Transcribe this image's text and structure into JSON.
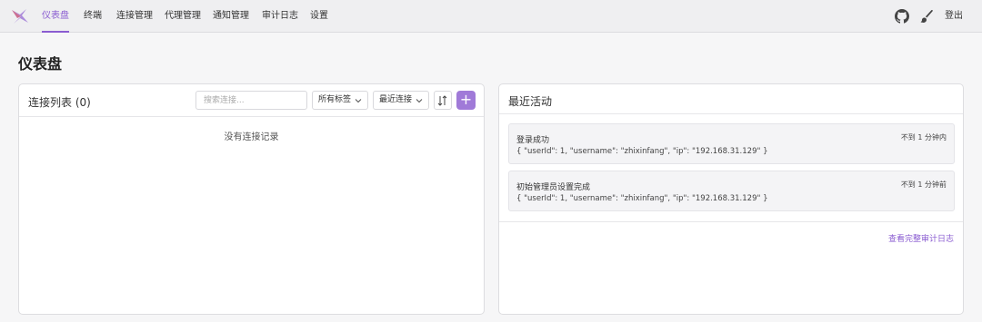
{
  "nav": {
    "items": [
      {
        "label": "仪表盘",
        "active": true
      },
      {
        "label": "终端"
      },
      {
        "label": "连接管理"
      },
      {
        "label": "代理管理"
      },
      {
        "label": "通知管理"
      },
      {
        "label": "审计日志"
      },
      {
        "label": "设置"
      }
    ],
    "logout_label": "登出",
    "icons": [
      "github-icon",
      "brush-icon"
    ]
  },
  "page_title": "仪表盘",
  "connections": {
    "title": "连接列表 (0)",
    "search_placeholder": "搜索连接...",
    "tag_filter": "所有标签",
    "sort_select": "最近连接",
    "add_button": "+",
    "empty_text": "没有连接记录"
  },
  "activity": {
    "title": "最近活动",
    "items": [
      {
        "title": "登录成功",
        "detail": "{ \"userId\": 1, \"username\": \"zhixinfang\", \"ip\": \"192.168.31.129\" }",
        "time": "不到 1 分钟内"
      },
      {
        "title": "初始管理员设置完成",
        "detail": "{ \"userId\": 1, \"username\": \"zhixinfang\", \"ip\": \"192.168.31.129\" }",
        "time": "不到 1 分钟前"
      }
    ],
    "view_all_label": "查看完整审计日志"
  },
  "colors": {
    "accent": "#8a5cd1",
    "add_button": "#a07ad8"
  }
}
